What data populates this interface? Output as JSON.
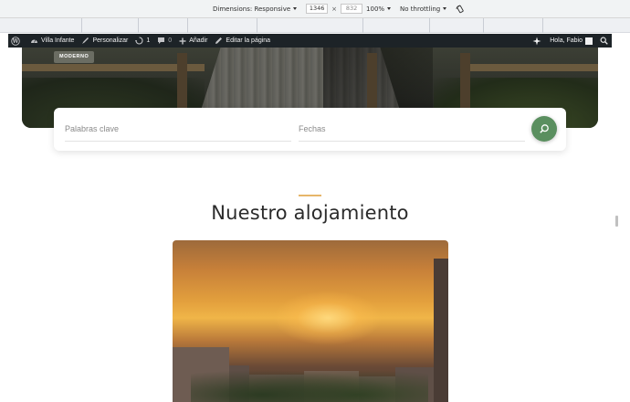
{
  "devtools": {
    "dimensions_label": "Dimensions: Responsive",
    "width": "1346",
    "height": "832",
    "times": "×",
    "zoom": "100%",
    "throttling": "No throttling"
  },
  "adminbar": {
    "site_name": "Villa Infante",
    "customize": "Personalizar",
    "updates_count": "1",
    "comments_count": "0",
    "add_new": "Añadir",
    "edit_page": "Editar la página",
    "greeting": "Hola, Fabio"
  },
  "hero": {
    "badge": "MODERNO"
  },
  "search": {
    "keywords_placeholder": "Palabras clave",
    "dates_placeholder": "Fechas"
  },
  "section": {
    "title": "Nuestro alojamiento"
  },
  "colors": {
    "accent": "#e6b66a",
    "search_button": "#5a8f5f",
    "adminbar": "#1d2327"
  }
}
